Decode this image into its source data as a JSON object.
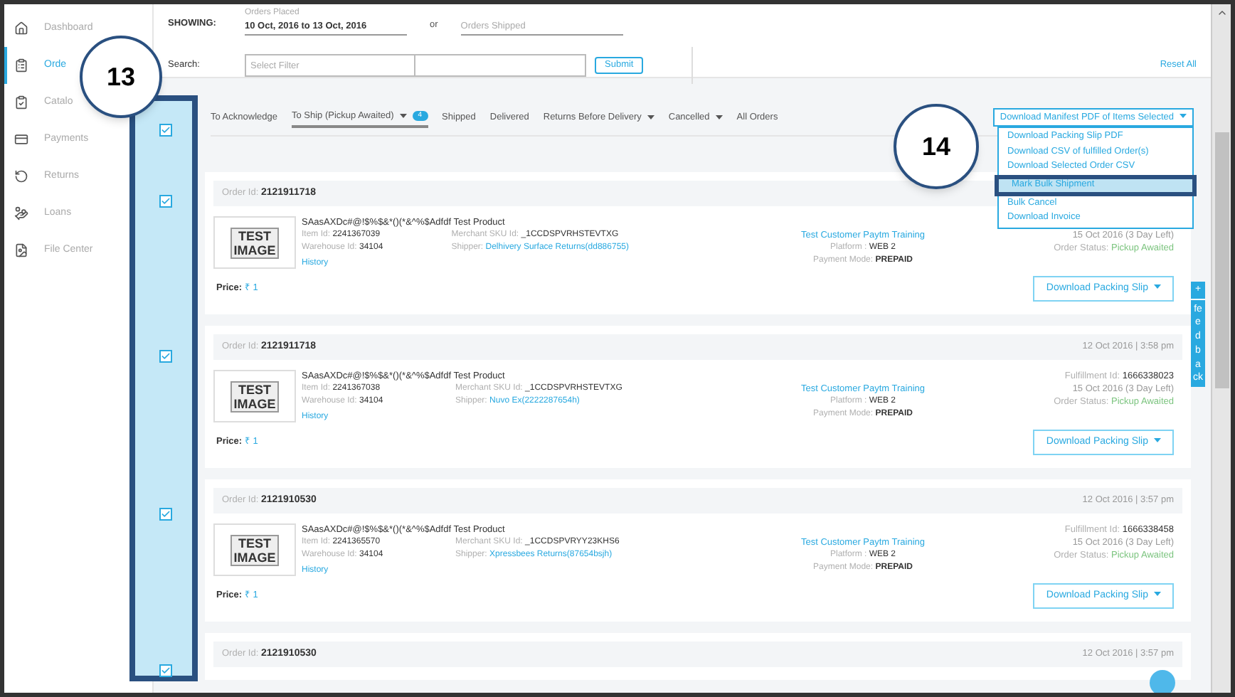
{
  "sidebar": {
    "items": [
      {
        "label": "Dashboard",
        "kind": "home",
        "selected": false
      },
      {
        "label": "Orde",
        "kind": "orders",
        "selected": true
      },
      {
        "label": "Catalo",
        "kind": "catalog",
        "selected": false
      },
      {
        "label": "Payments",
        "kind": "card",
        "selected": false
      },
      {
        "label": "Returns",
        "kind": "returns",
        "selected": false
      },
      {
        "label": "Loans",
        "kind": "loans",
        "selected": false
      },
      {
        "label": "File Center",
        "kind": "files",
        "selected": false
      }
    ]
  },
  "filters": {
    "showing_label": "SHOWING:",
    "orders_placed": {
      "label": "Orders Placed",
      "value": "10 Oct, 2016 to 13 Oct, 2016"
    },
    "or": "or",
    "orders_shipped": {
      "placeholder": "Orders Shipped"
    },
    "search_label": "Search:",
    "filter_field": {
      "placeholder": "Select Filter"
    },
    "submit": "Submit",
    "reset": "Reset All"
  },
  "tabs": [
    {
      "label": "To Acknowledge",
      "selected": false,
      "has_menu": false
    },
    {
      "label": "To Ship (Pickup Awaited)",
      "selected": true,
      "has_menu": true,
      "count": "4"
    },
    {
      "label": "Shipped",
      "selected": false,
      "has_menu": false
    },
    {
      "label": "Delivered",
      "selected": false,
      "has_menu": false
    },
    {
      "label": "Returns Before Delivery",
      "selected": false,
      "has_menu": true
    },
    {
      "label": "Cancelled",
      "selected": false,
      "has_menu": true
    },
    {
      "label": "All Orders",
      "selected": false,
      "has_menu": false
    }
  ],
  "bulk_menu": {
    "label": "Download Manifest PDF of Items Selected",
    "expanded": true,
    "items": [
      {
        "label": "Download Packing Slip PDF",
        "selected": false
      },
      {
        "label": "Download CSV of fulfilled Order(s)",
        "selected": false
      },
      {
        "label": "Download Selected Order CSV",
        "selected": false
      },
      {
        "label": "Mark Bulk Shipment",
        "selected": true
      },
      {
        "label": "Bulk Cancel",
        "selected": false
      },
      {
        "label": "Download Invoice",
        "selected": false
      }
    ]
  },
  "select_column": {
    "checkboxes": [
      {
        "checked": true
      },
      {
        "checked": true
      },
      {
        "checked": true
      },
      {
        "checked": true
      },
      {
        "checked": true
      }
    ]
  },
  "orders": [
    {
      "order_label": "Order Id:",
      "order_id": "2121911718",
      "image_text": "TEST IMAGE",
      "product": "SAasAXDc#@!$%$&*()(*&^%$Adfdf Test Product",
      "item_id": {
        "label": "Item Id:",
        "value": "2241367039"
      },
      "warehouse_id": {
        "label": "Warehouse Id:",
        "value": "34104"
      },
      "history": "History",
      "merchant_sku": {
        "label": "Merchant SKU Id:",
        "value": "_1CCDSPVRHSTEVTXG"
      },
      "shipper": {
        "label": "Shipper:",
        "value": "Delhivery Surface Returns(dd886755)"
      },
      "customer": "Test Customer Paytm Training",
      "platform": {
        "label": "Platform :",
        "value": "WEB 2"
      },
      "payment_mode": {
        "label": "Payment Mode:",
        "value": "PREPAID"
      },
      "due": "15 Oct 2016 (3 Day Left)",
      "status": {
        "label": "Order Status:",
        "value": "Pickup Awaited"
      },
      "price_label": "Price:",
      "price": "₹ 1",
      "button": "Download Packing Slip"
    },
    {
      "order_label": "Order Id:",
      "order_id": "2121911718",
      "date": "12 Oct 2016 | 3:58 pm",
      "image_text": "TEST IMAGE",
      "product": "SAasAXDc#@!$%$&*()(*&^%$Adfdf Test Product",
      "item_id": {
        "label": "Item Id:",
        "value": "2241367038"
      },
      "warehouse_id": {
        "label": "Warehouse Id:",
        "value": "34104"
      },
      "history": "History",
      "merchant_sku": {
        "label": "Merchant SKU Id:",
        "value": "_1CCDSPVRHSTEVTXG"
      },
      "shipper": {
        "label": "Shipper:",
        "value": "Nuvo Ex(2222287654h)"
      },
      "customer": "Test Customer Paytm Training",
      "platform": {
        "label": "Platform :",
        "value": "WEB 2"
      },
      "payment_mode": {
        "label": "Payment Mode:",
        "value": "PREPAID"
      },
      "fulfillment_id": {
        "label": "Fulfillment Id:",
        "value": "1666338023"
      },
      "due": "15 Oct 2016 (3 Day Left)",
      "status": {
        "label": "Order Status:",
        "value": "Pickup Awaited"
      },
      "price_label": "Price:",
      "price": "₹ 1",
      "button": "Download Packing Slip"
    },
    {
      "order_label": "Order Id:",
      "order_id": "2121910530",
      "date": "12 Oct 2016 | 3:57 pm",
      "image_text": "TEST IMAGE",
      "product": "SAasAXDc#@!$%$&*()(*&^%$Adfdf Test Product",
      "item_id": {
        "label": "Item Id:",
        "value": "2241365570"
      },
      "warehouse_id": {
        "label": "Warehouse Id:",
        "value": "34104"
      },
      "history": "History",
      "merchant_sku": {
        "label": "Merchant SKU Id:",
        "value": "_1CCDSPVRYY23KHS6"
      },
      "shipper": {
        "label": "Shipper:",
        "value": "Xpressbees Returns(87654bsjh)"
      },
      "customer": "Test Customer Paytm Training",
      "platform": {
        "label": "Platform :",
        "value": "WEB 2"
      },
      "payment_mode": {
        "label": "Payment Mode:",
        "value": "PREPAID"
      },
      "fulfillment_id": {
        "label": "Fulfillment Id:",
        "value": "1666338458"
      },
      "due": "15 Oct 2016 (3 Day Left)",
      "status": {
        "label": "Order Status:",
        "value": "Pickup Awaited"
      },
      "price_label": "Price:",
      "price": "₹ 1",
      "button": "Download Packing Slip"
    },
    {
      "order_label": "Order Id:",
      "order_id": "2121910530",
      "date": "12 Oct 2016 | 3:57 pm"
    }
  ],
  "feedback": {
    "plus": "+",
    "label": "feedback"
  },
  "callouts": [
    {
      "number": "13"
    },
    {
      "number": "14"
    }
  ]
}
